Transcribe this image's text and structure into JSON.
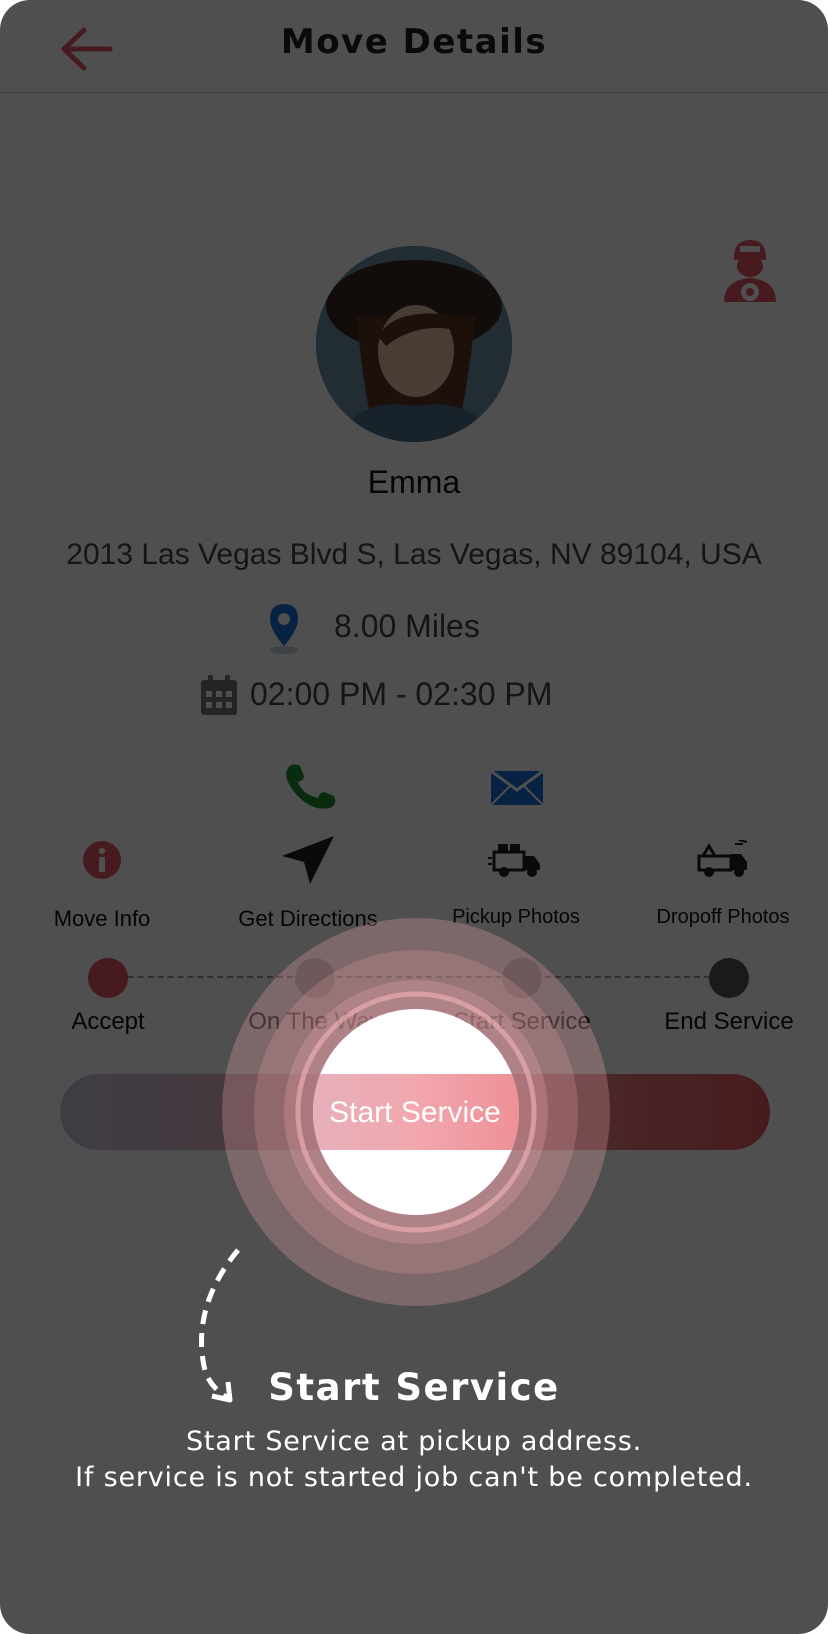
{
  "header": {
    "title": "Move Details",
    "back_icon": "arrow-left-icon",
    "accent_color": "#e05560"
  },
  "customer": {
    "name": "Emma",
    "address": "2013 Las Vegas Blvd S, Las Vegas, NV 89104, USA",
    "distance": "8.00 Miles",
    "time_window": "02:00 PM - 02:30 PM",
    "avatar_icon": "customer-photo"
  },
  "contact": {
    "phone_icon": "phone-icon",
    "phone_color": "#1f8f2e",
    "mail_icon": "mail-icon",
    "mail_color": "#1a6ed8"
  },
  "actions": [
    {
      "label": "Move Info",
      "icon": "info-icon"
    },
    {
      "label": "Get Directions",
      "icon": "navigation-arrow-icon"
    },
    {
      "label": "Pickup Photos",
      "icon": "truck-loaded-icon"
    },
    {
      "label": "Dropoff Photos",
      "icon": "truck-unloading-icon"
    }
  ],
  "steps": [
    {
      "label": "Accept",
      "state": "done",
      "color": "#e05560"
    },
    {
      "label": "On The Way",
      "state": "pending",
      "color": "#bdbdbd"
    },
    {
      "label": "Start Service",
      "state": "pending",
      "color": "#bdbdbd"
    },
    {
      "label": "End Service",
      "state": "pending",
      "color": "#555555"
    }
  ],
  "primary_button": {
    "label": "Start Service"
  },
  "tooltip": {
    "title": "Start Service",
    "line1": "Start Service at pickup address.",
    "line2": "If service is not started job can't be completed."
  }
}
